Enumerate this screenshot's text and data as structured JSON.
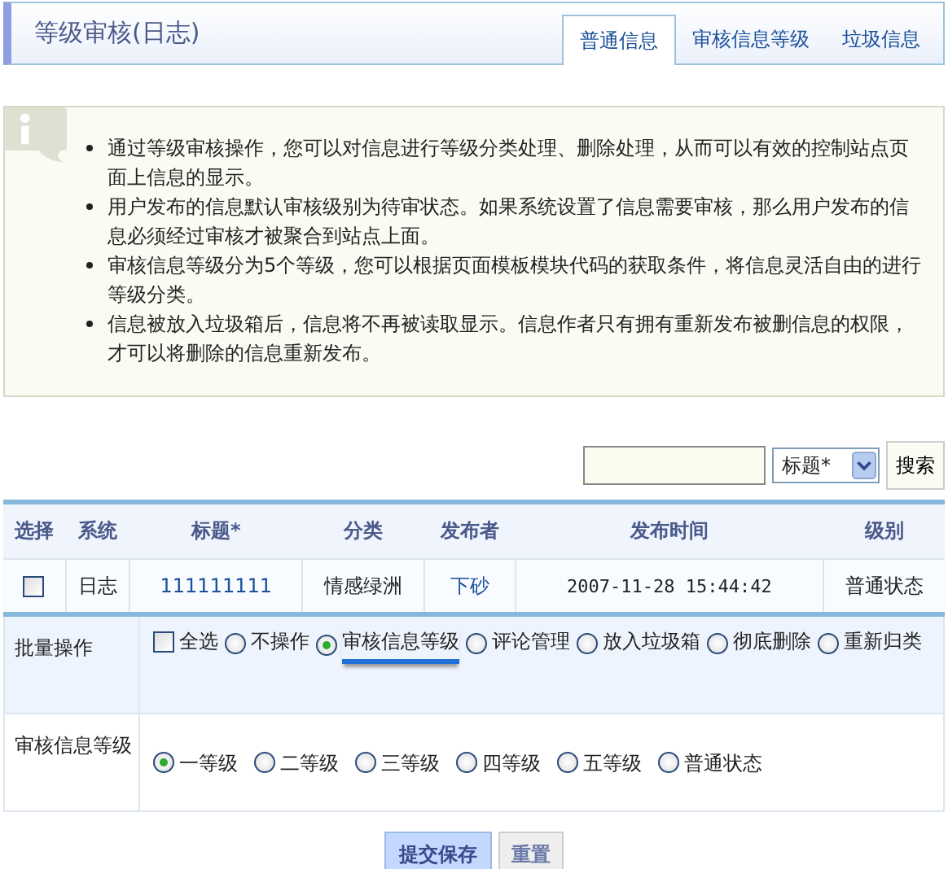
{
  "header": {
    "title": "等级审核(日志)",
    "tabs": [
      {
        "label": "普通信息",
        "selected": true
      },
      {
        "label": "审核信息等级",
        "selected": false
      },
      {
        "label": "垃圾信息",
        "selected": false
      }
    ]
  },
  "notice": {
    "items": [
      "通过等级审核操作，您可以对信息进行等级分类处理、删除处理，从而可以有效的控制站点页面上信息的显示。",
      "用户发布的信息默认审核级别为待审状态。如果系统设置了信息需要审核，那么用户发布的信息必须经过审核才被聚合到站点上面。",
      "审核信息等级分为5个等级，您可以根据页面模板模块代码的获取条件，将信息灵活自由的进行等级分类。",
      "信息被放入垃圾箱后，信息将不再被读取显示。信息作者只有拥有重新发布被删信息的权限，才可以将删除的信息重新发布。"
    ]
  },
  "search": {
    "field_select": "标题*",
    "button": "搜索"
  },
  "table": {
    "columns": [
      "选择",
      "系统",
      "标题*",
      "分类",
      "发布者",
      "发布时间",
      "级别"
    ],
    "rows": [
      {
        "checked": false,
        "system": "日志",
        "title": "111111111",
        "category": "情感绿洲",
        "author": "下砂",
        "time": "2007-11-28 15:44:42",
        "level": "普通状态"
      }
    ]
  },
  "batch": {
    "label": "批量操作",
    "select_all": {
      "label": "全选",
      "checked": false
    },
    "options": [
      {
        "label": "不操作",
        "selected": false
      },
      {
        "label": "审核信息等级",
        "selected": true
      },
      {
        "label": "评论管理",
        "selected": false
      },
      {
        "label": "放入垃圾箱",
        "selected": false
      },
      {
        "label": "彻底删除",
        "selected": false
      },
      {
        "label": "重新归类",
        "selected": false
      }
    ]
  },
  "grade": {
    "label": "审核信息等级",
    "options": [
      {
        "label": "一等级",
        "selected": true
      },
      {
        "label": "二等级",
        "selected": false
      },
      {
        "label": "三等级",
        "selected": false
      },
      {
        "label": "四等级",
        "selected": false
      },
      {
        "label": "五等级",
        "selected": false
      },
      {
        "label": "普通状态",
        "selected": false
      }
    ]
  },
  "buttons": [
    "提交保存",
    "重置"
  ]
}
